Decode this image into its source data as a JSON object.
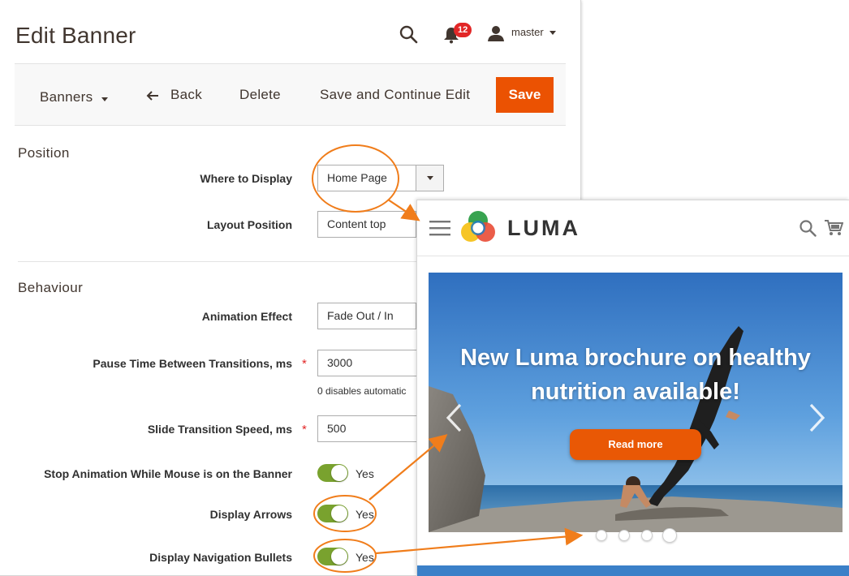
{
  "admin": {
    "title": "Edit Banner",
    "header": {
      "notification_count": "12",
      "user_name": "master"
    },
    "action_bar": {
      "banners_label": "Banners",
      "back_label": "Back",
      "delete_label": "Delete",
      "save_continue_label": "Save and Continue Edit",
      "save_label": "Save",
      "accent_color": "#eb5202"
    },
    "position": {
      "section_title": "Position",
      "where_label": "Where to Display",
      "where_value": "Home Page",
      "layout_label": "Layout Position",
      "layout_value": "Content top"
    },
    "behaviour": {
      "section_title": "Behaviour",
      "animation_label": "Animation Effect",
      "animation_value": "Fade Out / In",
      "pause_label": "Pause Time Between Transitions, ms",
      "pause_value": "3000",
      "pause_note": "0 disables automatic",
      "speed_label": "Slide Transition Speed, ms",
      "speed_value": "500",
      "stop_label": "Stop Animation While Mouse is on the Banner",
      "stop_value": "Yes",
      "arrows_label": "Display Arrows",
      "arrows_value": "Yes",
      "bullets_label": "Display Navigation Bullets",
      "bullets_value": "Yes",
      "toggle_color": "#79a22e"
    }
  },
  "store": {
    "brand": "LUMA",
    "banner": {
      "headline": "New Luma brochure on healthy nutrition available!",
      "button_label": "Read more",
      "button_color": "#e95805"
    },
    "bullets": {
      "count": 4,
      "active_index": 3
    }
  },
  "callout_color": "#f07d1b"
}
